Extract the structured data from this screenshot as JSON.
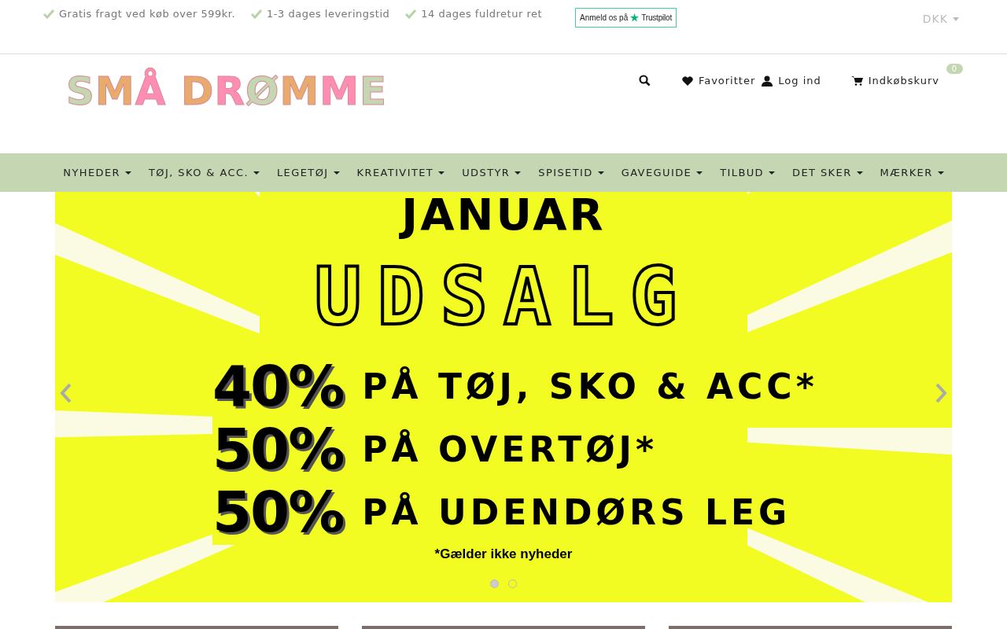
{
  "usp_bar": {
    "items": [
      "Gratis fragt ved køb over 599kr.",
      "1-3 dages leveringstid",
      "14 dages fuldretur ret"
    ],
    "trustpilot": {
      "prefix": "Anmeld os på",
      "brand": "Trustpilot"
    },
    "currency": "DKK"
  },
  "header": {
    "logo": "SMÅ DRØMME",
    "links": [
      {
        "kind": "favorites",
        "label": "Favoritter"
      },
      {
        "kind": "login",
        "label": "Log ind"
      }
    ],
    "cart": {
      "label": "Indkøbskurv",
      "count": "0"
    }
  },
  "nav": [
    "NYHEDER",
    "TØJ, SKO & ACC.",
    "LEGETØJ",
    "KREATIVITET",
    "UDSTYR",
    "SPISETID",
    "GAVEGUIDE",
    "TILBUD",
    "DET SKER",
    "MÆRKER"
  ],
  "banner": {
    "title": "JANUAR",
    "subtitle": "UDSALG",
    "offers": [
      {
        "percent": "40%",
        "text": "PÅ TØJ, SKO & ACC*"
      },
      {
        "percent": "50%",
        "text": "PÅ OVERTØJ*"
      },
      {
        "percent": "50%",
        "text": "PÅ UDENDØRS LEG"
      }
    ],
    "note": "*Gælder ikke nyheder",
    "dots": [
      {
        "selected": true
      },
      {
        "selected": false
      }
    ]
  }
}
